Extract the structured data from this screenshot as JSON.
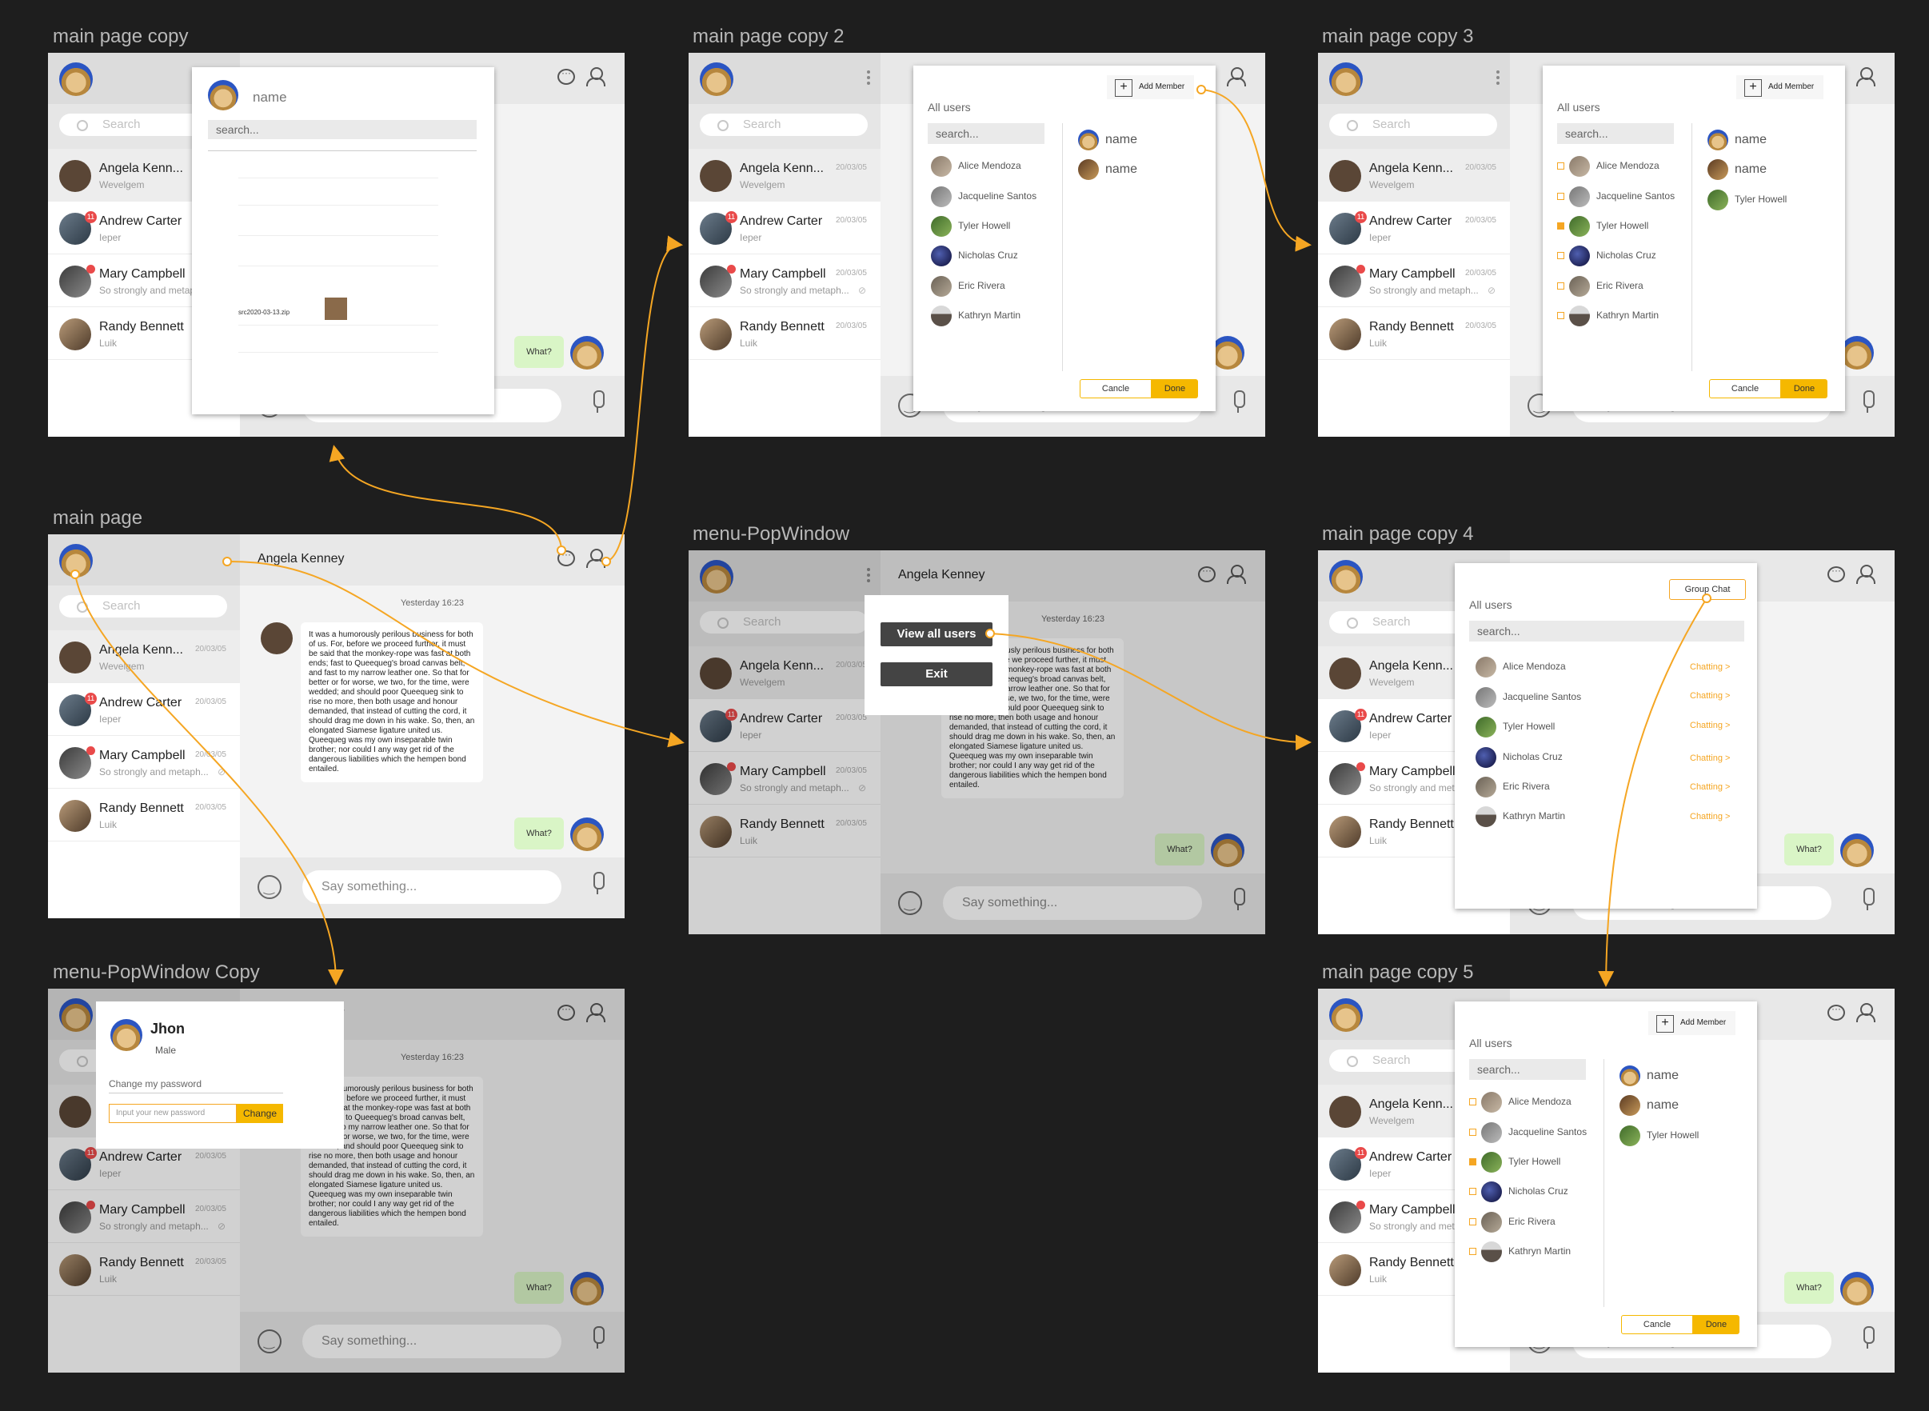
{
  "frames": {
    "copy": "main page copy",
    "copy2": "main page copy 2",
    "copy3": "main page copy 3",
    "main": "main page",
    "menu": "menu-PopWindow",
    "copy4": "main page copy 4",
    "menu_copy": "menu-PopWindow Copy",
    "copy5": "main page copy 5"
  },
  "sidebar": {
    "search_placeholder": "Search",
    "conversations": [
      {
        "name": "Angela Kenn...",
        "sub": "Wevelgem",
        "date": "20/03/05"
      },
      {
        "name": "Andrew Carter",
        "sub": "Ieper",
        "date": "20/03/05",
        "badge": "11"
      },
      {
        "name": "Mary Campbell",
        "sub": "So strongly and metaph...",
        "date": "20/03/05"
      },
      {
        "name": "Randy Bennett",
        "sub": "Luik",
        "date": "20/03/05"
      }
    ]
  },
  "chat": {
    "title": "Angela Kenney",
    "time": "Yesterday 16:23",
    "message": "It was a humorously perilous business for both of us. For, before we proceed further, it must be said that the monkey-rope was fast at both ends; fast to Queequeg's broad canvas belt, and fast to my narrow leather one. So that for better or for worse, we two, for the time, were wedded; and should poor Queequeg sink to rise no more, then both usage and honour demanded, that instead of cutting the cord, it should drag me down in his wake. So, then, an elongated Siamese ligature united us. Queequeg was my own inseparable twin brother; nor could I any way get rid of the dangerous liabilities which the hempen bond entailed.",
    "reply": "What?",
    "input_placeholder": "Say something..."
  },
  "history_popup": {
    "name": "name",
    "search": "search...",
    "file": "src2020-03-13.zip"
  },
  "users_panel": {
    "label": "All users",
    "search": "search...",
    "add_member": "Add Member",
    "group_chat": "Group Chat",
    "cancel": "Cancle",
    "done": "Done",
    "chatting": "Chatting >",
    "users": [
      "Alice Mendoza",
      "Jacqueline Santos",
      "Tyler Howell",
      "Nicholas Cruz",
      "Eric Rivera",
      "Kathryn Martin"
    ],
    "selected": [
      "name",
      "name",
      "Tyler Howell"
    ]
  },
  "menu_popup": {
    "view_all": "View all users",
    "exit": "Exit"
  },
  "profile_popup": {
    "name": "Jhon",
    "gender": "Male",
    "change_label": "Change my password",
    "input_placeholder": "Input your new password",
    "change_button": "Change"
  },
  "colors": {
    "accent": "#f5a623",
    "done": "#f5b800",
    "reply_bubble": "#d9f5c6"
  }
}
